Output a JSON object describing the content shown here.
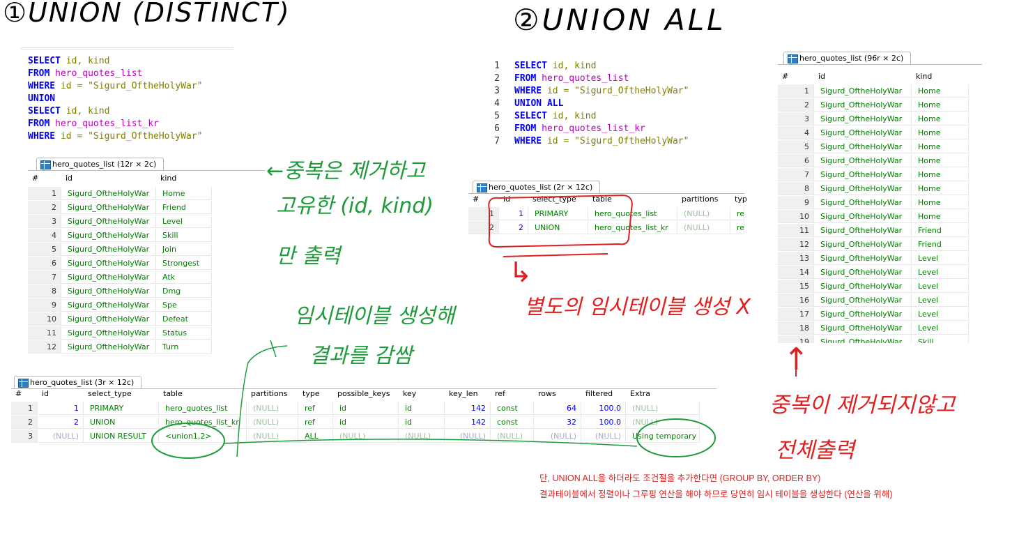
{
  "headings": {
    "union_distinct": "①UNION (DISTINCT)",
    "union_all": "②UNION ALL"
  },
  "query1": {
    "lines": [
      [
        {
          "t": "SELECT",
          "c": "kw"
        },
        {
          "t": " id, kind",
          "c": "str"
        }
      ],
      [
        {
          "t": "FROM",
          "c": "kw"
        },
        {
          "t": " hero_quotes_list",
          "c": "tbl"
        }
      ],
      [
        {
          "t": "WHERE",
          "c": "kw"
        },
        {
          "t": " id = \"Sigurd_OftheHolyWar\"",
          "c": "str"
        }
      ],
      [
        {
          "t": "UNION",
          "c": "kw"
        }
      ],
      [
        {
          "t": "SELECT",
          "c": "kw"
        },
        {
          "t": " id, kind",
          "c": "str"
        }
      ],
      [
        {
          "t": "FROM",
          "c": "kw"
        },
        {
          "t": " hero_quotes_list_kr",
          "c": "tbl"
        }
      ],
      [
        {
          "t": "WHERE",
          "c": "kw"
        },
        {
          "t": " id = \"Sigurd_OftheHolyWar\"",
          "c": "str"
        }
      ]
    ]
  },
  "query2": {
    "line_numbers": [
      "1",
      "2",
      "3",
      "4",
      "5",
      "6",
      "7"
    ],
    "lines": [
      [
        {
          "t": "SELECT",
          "c": "kw"
        },
        {
          "t": " id, kind",
          "c": "str"
        }
      ],
      [
        {
          "t": "FROM",
          "c": "kw"
        },
        {
          "t": " hero_quotes_list",
          "c": "tbl"
        }
      ],
      [
        {
          "t": "WHERE",
          "c": "kw"
        },
        {
          "t": " id = \"Sigurd_OftheHolyWar\"",
          "c": "str"
        }
      ],
      [
        {
          "t": "UNION ALL",
          "c": "kw"
        }
      ],
      [
        {
          "t": "SELECT",
          "c": "kw"
        },
        {
          "t": " id, kind",
          "c": "str"
        }
      ],
      [
        {
          "t": "FROM",
          "c": "kw"
        },
        {
          "t": " hero_quotes_list_kr",
          "c": "tbl"
        }
      ],
      [
        {
          "t": "WHERE",
          "c": "kw"
        },
        {
          "t": " id = \"Sigurd_OftheHolyWar\"",
          "c": "str"
        }
      ]
    ]
  },
  "result_union": {
    "tab": "hero_quotes_list (12r × 2c)",
    "columns": [
      "#",
      "id",
      "kind"
    ],
    "rows": [
      [
        "1",
        "Sigurd_OftheHolyWar",
        "Home"
      ],
      [
        "2",
        "Sigurd_OftheHolyWar",
        "Friend"
      ],
      [
        "3",
        "Sigurd_OftheHolyWar",
        "Level"
      ],
      [
        "4",
        "Sigurd_OftheHolyWar",
        "Skill"
      ],
      [
        "5",
        "Sigurd_OftheHolyWar",
        "Join"
      ],
      [
        "6",
        "Sigurd_OftheHolyWar",
        "Strongest"
      ],
      [
        "7",
        "Sigurd_OftheHolyWar",
        "Atk"
      ],
      [
        "8",
        "Sigurd_OftheHolyWar",
        "Dmg"
      ],
      [
        "9",
        "Sigurd_OftheHolyWar",
        "Spe"
      ],
      [
        "10",
        "Sigurd_OftheHolyWar",
        "Defeat"
      ],
      [
        "11",
        "Sigurd_OftheHolyWar",
        "Status"
      ],
      [
        "12",
        "Sigurd_OftheHolyWar",
        "Turn"
      ]
    ]
  },
  "explain_union": {
    "tab": "hero_quotes_list (3r × 12c)",
    "columns": [
      "#",
      "id",
      "select_type",
      "table",
      "partitions",
      "type",
      "possible_keys",
      "key",
      "key_len",
      "ref",
      "rows",
      "filtered",
      "Extra"
    ],
    "rows": [
      [
        "1",
        "1",
        "PRIMARY",
        "hero_quotes_list",
        "(NULL)",
        "ref",
        "id",
        "id",
        "142",
        "const",
        "64",
        "100.0",
        "(NULL)"
      ],
      [
        "2",
        "2",
        "UNION",
        "hero_quotes_list_kr",
        "(NULL)",
        "ref",
        "id",
        "id",
        "142",
        "const",
        "32",
        "100.0",
        "(NULL)"
      ],
      [
        "3",
        "(NULL)",
        "UNION RESULT",
        "<union1,2>",
        "(NULL)",
        "ALL",
        "(NULL)",
        "(NULL)",
        "(NULL)",
        "(NULL)",
        "(NULL)",
        "(NULL)",
        "Using temporary"
      ]
    ]
  },
  "explain_union_all": {
    "tab": "hero_quotes_list (2r × 12c)",
    "columns": [
      "#",
      "id",
      "select_type",
      "table",
      "partitions",
      "typ"
    ],
    "rows": [
      [
        "1",
        "1",
        "PRIMARY",
        "hero_quotes_list",
        "(NULL)",
        "ref"
      ],
      [
        "2",
        "2",
        "UNION",
        "hero_quotes_list_kr",
        "(NULL)",
        "ref"
      ]
    ]
  },
  "result_union_all": {
    "tab": "hero_quotes_list (96r × 2c)",
    "columns": [
      "#",
      "id",
      "kind"
    ],
    "rows": [
      [
        "1",
        "Sigurd_OftheHolyWar",
        "Home"
      ],
      [
        "2",
        "Sigurd_OftheHolyWar",
        "Home"
      ],
      [
        "3",
        "Sigurd_OftheHolyWar",
        "Home"
      ],
      [
        "4",
        "Sigurd_OftheHolyWar",
        "Home"
      ],
      [
        "5",
        "Sigurd_OftheHolyWar",
        "Home"
      ],
      [
        "6",
        "Sigurd_OftheHolyWar",
        "Home"
      ],
      [
        "7",
        "Sigurd_OftheHolyWar",
        "Home"
      ],
      [
        "8",
        "Sigurd_OftheHolyWar",
        "Home"
      ],
      [
        "9",
        "Sigurd_OftheHolyWar",
        "Home"
      ],
      [
        "10",
        "Sigurd_OftheHolyWar",
        "Home"
      ],
      [
        "11",
        "Sigurd_OftheHolyWar",
        "Friend"
      ],
      [
        "12",
        "Sigurd_OftheHolyWar",
        "Friend"
      ],
      [
        "13",
        "Sigurd_OftheHolyWar",
        "Level"
      ],
      [
        "14",
        "Sigurd_OftheHolyWar",
        "Level"
      ],
      [
        "15",
        "Sigurd_OftheHolyWar",
        "Level"
      ],
      [
        "16",
        "Sigurd_OftheHolyWar",
        "Level"
      ],
      [
        "17",
        "Sigurd_OftheHolyWar",
        "Level"
      ],
      [
        "18",
        "Sigurd_OftheHolyWar",
        "Level"
      ],
      [
        "19",
        "Sigurd_OftheHolyWar",
        "Skill"
      ]
    ]
  },
  "annotations": {
    "dedup_line1": "←중복은 제거하고",
    "dedup_line2": "고유한 (id, kind)",
    "dedup_line3": "만 출력",
    "temp_line1": "임시테이블 생성해",
    "temp_line2": "결과를 감쌈",
    "no_temp_arrow": "↳",
    "no_temp": "별도의 임시테이블 생성 X",
    "up_arrow": "↑",
    "no_dedup_line1": "중복이 제거되지않고",
    "no_dedup_line2": "전체출력",
    "note_line1": "단, UNION ALL을 하더라도 조건절을 추가한다면 (GROUP BY, ORDER BY)",
    "note_line2": "결과테이블에서 정렬이나 그루핑 연산을 해야 하므로 당연히 임시 테이블을 생성한다 (연산을 위해)"
  },
  "colors": {
    "keyword": "#0000ff",
    "table_name": "#c000c0",
    "string": "#808000",
    "cell_text": "#008000",
    "number": "#0000ff",
    "annotation_green": "#1e9a3a",
    "annotation_red": "#e02020"
  }
}
